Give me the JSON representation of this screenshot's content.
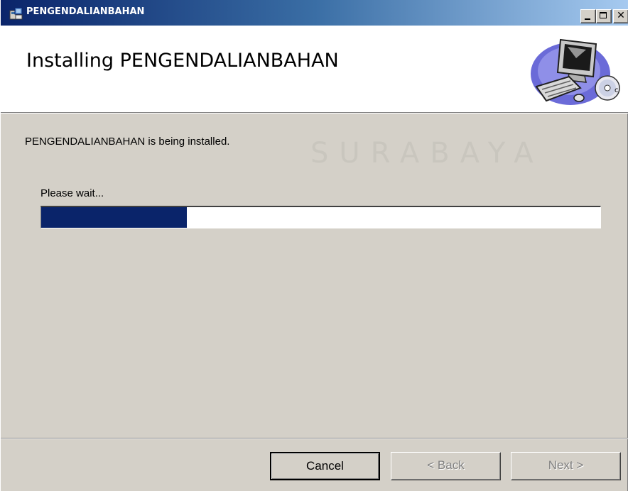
{
  "window": {
    "title": "PENGENDALIANBAHAN",
    "controls": {
      "minimize": "",
      "maximize": "",
      "close": "✕"
    }
  },
  "header": {
    "title": "Installing PENGENDALIANBAHAN"
  },
  "status": {
    "message": "PENGENDALIANBAHAN is being installed."
  },
  "progress": {
    "label": "Please wait...",
    "fraction": 0.26
  },
  "watermark": {
    "text": "SURABAYA"
  },
  "buttons": {
    "cancel": "Cancel",
    "back": "< Back",
    "next": "Next >"
  },
  "colors": {
    "titlebar_start": "#0a246a",
    "titlebar_end": "#a6caf0",
    "progress_fill": "#0a246a",
    "dialog_bg": "#d4d0c8"
  }
}
